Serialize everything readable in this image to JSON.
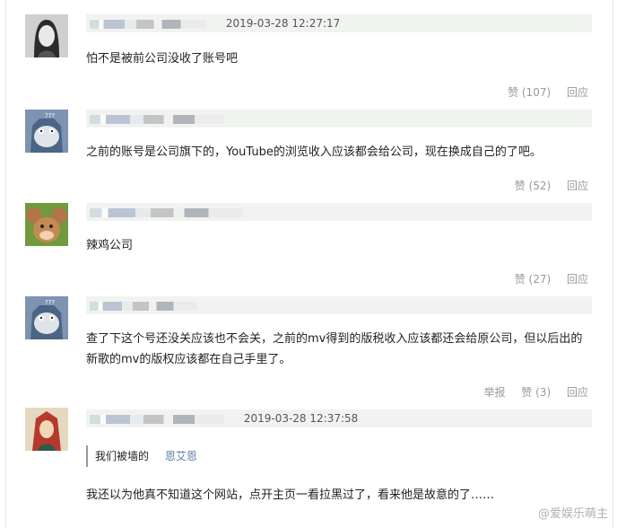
{
  "comments": [
    {
      "time": "2019-03-28 12:27:17",
      "text": "怕不是被前公司没收了账号吧",
      "like": "赞 (107)",
      "reply": "回应"
    },
    {
      "time": "",
      "text": "之前的账号是公司旗下的，YouTube的浏览收入应该都会给公司，现在换成自己的了吧。",
      "like": "赞 (52)",
      "reply": "回应"
    },
    {
      "time": "",
      "text": "辣鸡公司",
      "like": "赞 (27)",
      "reply": "回应"
    },
    {
      "time": "",
      "text": "查了下这个号还没关应该也不会关，之前的mv得到的版税收入应该都还会给原公司，但以后出的新歌的mv的版权应该都在自己手里了。",
      "report": "举报",
      "like": "赞 (3)",
      "reply": "回应"
    },
    {
      "time": "2019-03-28 12:37:58",
      "quote_text": "我们被墙的",
      "quote_user": "恩艾恩",
      "text": "我还以为他真不知道这个网站，点开主页一看拉黑过了，看来他是故意的了……"
    }
  ],
  "watermark": "@爱娱乐萌主"
}
